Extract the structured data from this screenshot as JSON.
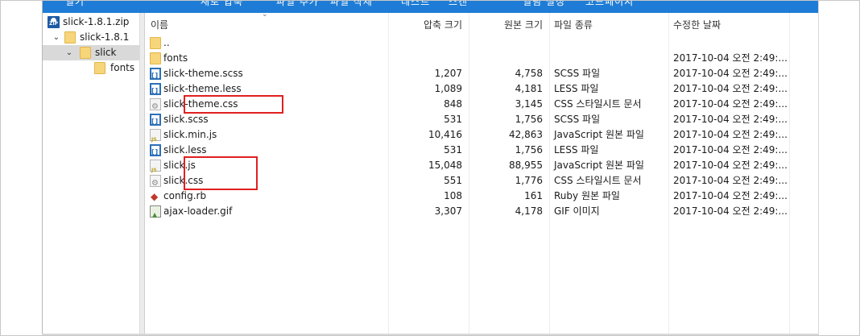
{
  "toolbar": {
    "items": [
      "열기",
      "새로 압축",
      "파일 추가",
      "파일 삭제",
      "테스트",
      "스캔",
      "열림 설정",
      "코드페이지"
    ]
  },
  "tree": {
    "items": [
      {
        "label": "slick-1.8.1.zip",
        "icon": "zip-archive-icon"
      },
      {
        "label": "slick-1.8.1",
        "icon": "folder-icon",
        "expanded": true
      },
      {
        "label": "slick",
        "icon": "folder-icon",
        "expanded": true,
        "selected": true
      },
      {
        "label": "fonts",
        "icon": "folder-icon"
      }
    ]
  },
  "columns": {
    "name": "이름",
    "compressed": "압축 크기",
    "original": "원본 크기",
    "type": "파일 종류",
    "modified": "수정한 날짜"
  },
  "files": [
    {
      "name": "..",
      "icon": "folder-icon",
      "compressed": "",
      "original": "",
      "type": "",
      "modified": ""
    },
    {
      "name": "fonts",
      "icon": "folder-icon",
      "compressed": "",
      "original": "",
      "type": "",
      "modified": "2017-10-04 오전 2:49:..."
    },
    {
      "name": "slick-theme.scss",
      "icon": "scss-file-icon",
      "compressed": "1,207",
      "original": "4,758",
      "type": "SCSS 파일",
      "modified": "2017-10-04 오전 2:49:..."
    },
    {
      "name": "slick-theme.less",
      "icon": "less-file-icon",
      "compressed": "1,089",
      "original": "4,181",
      "type": "LESS 파일",
      "modified": "2017-10-04 오전 2:49:..."
    },
    {
      "name": "slick-theme.css",
      "icon": "css-file-icon",
      "compressed": "848",
      "original": "3,145",
      "type": "CSS 스타일시트 문서",
      "modified": "2017-10-04 오전 2:49:..."
    },
    {
      "name": "slick.scss",
      "icon": "scss-file-icon",
      "compressed": "531",
      "original": "1,756",
      "type": "SCSS 파일",
      "modified": "2017-10-04 오전 2:49:..."
    },
    {
      "name": "slick.min.js",
      "icon": "js-file-icon",
      "compressed": "10,416",
      "original": "42,863",
      "type": "JavaScript 원본 파일",
      "modified": "2017-10-04 오전 2:49:..."
    },
    {
      "name": "slick.less",
      "icon": "less-file-icon",
      "compressed": "531",
      "original": "1,756",
      "type": "LESS 파일",
      "modified": "2017-10-04 오전 2:49:..."
    },
    {
      "name": "slick.js",
      "icon": "js-file-icon",
      "compressed": "15,048",
      "original": "88,955",
      "type": "JavaScript 원본 파일",
      "modified": "2017-10-04 오전 2:49:..."
    },
    {
      "name": "slick.css",
      "icon": "css-file-icon",
      "compressed": "551",
      "original": "1,776",
      "type": "CSS 스타일시트 문서",
      "modified": "2017-10-04 오전 2:49:..."
    },
    {
      "name": "config.rb",
      "icon": "ruby-file-icon",
      "compressed": "108",
      "original": "161",
      "type": "Ruby 원본 파일",
      "modified": "2017-10-04 오전 2:49:..."
    },
    {
      "name": "ajax-loader.gif",
      "icon": "gif-image-icon",
      "compressed": "3,307",
      "original": "4,178",
      "type": "GIF 이미지",
      "modified": "2017-10-04 오전 2:49:..."
    }
  ],
  "colors": {
    "toolbar_bg": "#1e7cd6",
    "selection_bg": "#d9d9d9",
    "highlight_border": "#e02020",
    "folder": "#f7d57a"
  }
}
